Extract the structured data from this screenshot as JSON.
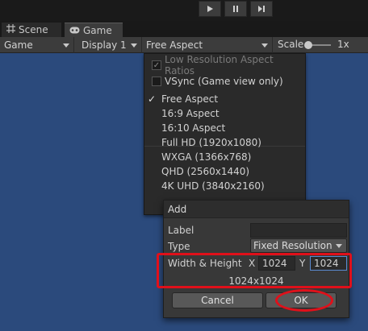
{
  "playbar": {
    "buttons": [
      {
        "name": "play-icon"
      },
      {
        "name": "pause-icon"
      },
      {
        "name": "step-icon"
      }
    ]
  },
  "tabs": [
    {
      "label": "Scene",
      "icon": "grid-icon"
    },
    {
      "label": "Game",
      "icon": "gamepad-icon"
    }
  ],
  "toolbar": {
    "display_mode": "Game",
    "display": "Display 1",
    "aspect": "Free Aspect",
    "scale_label": "Scale",
    "scale_value": "1x"
  },
  "aspect_menu": {
    "low_res_label": "Low Resolution Aspect Ratios",
    "low_res_checked": true,
    "vsync_label": "VSync (Game view only)",
    "vsync_checked": false,
    "items": [
      {
        "label": "Free Aspect",
        "selected": true
      },
      {
        "label": "16:9 Aspect",
        "selected": false
      },
      {
        "label": "16:10 Aspect",
        "selected": false
      },
      {
        "label": "Full HD (1920x1080)",
        "selected": false
      },
      {
        "label": "WXGA (1366x768)",
        "selected": false
      },
      {
        "label": "QHD (2560x1440)",
        "selected": false
      },
      {
        "label": "4K UHD (3840x2160)",
        "selected": false
      }
    ],
    "check_glyph": "✓"
  },
  "add_dialog": {
    "title": "Add",
    "label_label": "Label",
    "label_value": "",
    "type_label": "Type",
    "type_value": "Fixed Resolution",
    "size_label": "Width & Height",
    "x_label": "X",
    "x_value": "1024",
    "y_label": "Y",
    "y_value": "1024",
    "resolution_text": "1024x1024",
    "cancel_label": "Cancel",
    "ok_label": "OK"
  },
  "colors": {
    "viewport": "#2b4a7c",
    "highlight": "#e0101a"
  }
}
